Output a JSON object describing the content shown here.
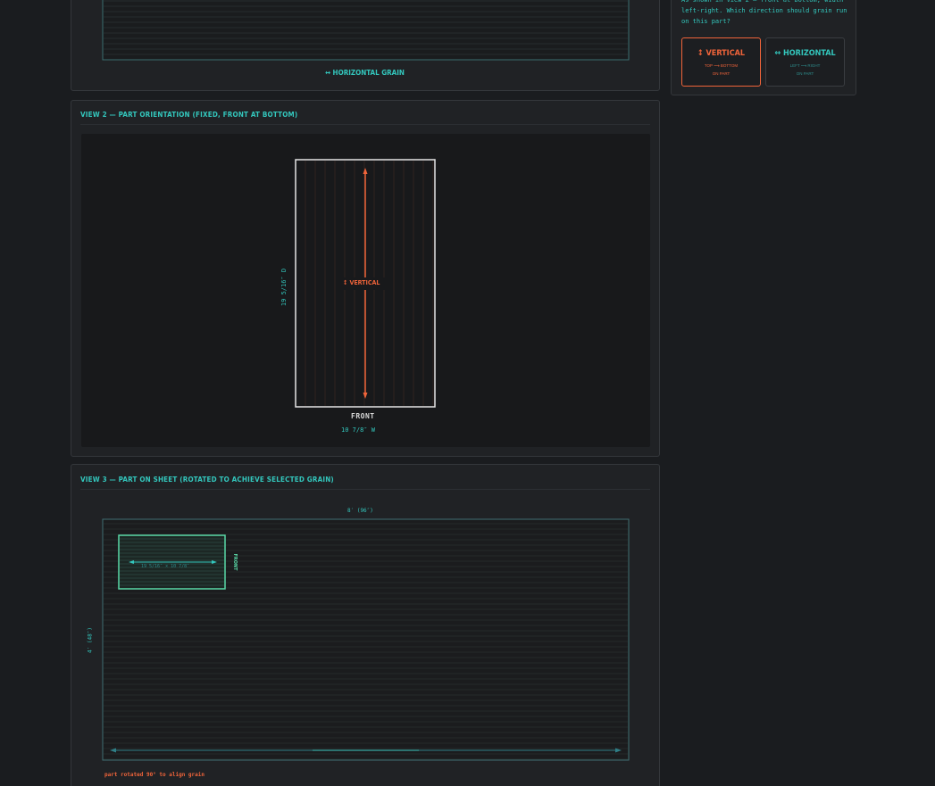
{
  "view1": {
    "grain_label": "HORIZONTAL GRAIN",
    "grain_arrow": "↔"
  },
  "view2": {
    "title": "VIEW 2 — PART ORIENTATION (FIXED, FRONT AT BOTTOM)",
    "grain_tag": "↕ VERTICAL",
    "front_label": "FRONT",
    "width_label": "10 7/8″ W",
    "depth_label": "19 5/16″ D"
  },
  "view3": {
    "title": "VIEW 3 — PART ON SHEET (ROTATED TO ACHIEVE SELECTED GRAIN)",
    "sheet_width_label": "8′ (96″)",
    "sheet_height_label": "4′ (48″)",
    "part_label": "19 5/16″ × 10 7/8″",
    "part_front_label": "FRONT",
    "note": "part rotated 90° to align grain"
  },
  "sidebar": {
    "question": "As shown in View 2 — front at bottom, width left-right. Which direction should grain run on this part?",
    "options": [
      {
        "icon": "↕",
        "label": "VERTICAL",
        "sub1": "TOP ⟶ BOTTOM",
        "sub2": "ON PART",
        "selected": true
      },
      {
        "icon": "↔",
        "label": "HORIZONTAL",
        "sub1": "LEFT ⟶ RIGHT",
        "sub2": "ON PART",
        "selected": false
      }
    ]
  },
  "colors": {
    "accent_teal": "#33c7bd",
    "accent_orange": "#f0643a",
    "part_green": "#59d8a6",
    "background": "#1a1c1f"
  }
}
